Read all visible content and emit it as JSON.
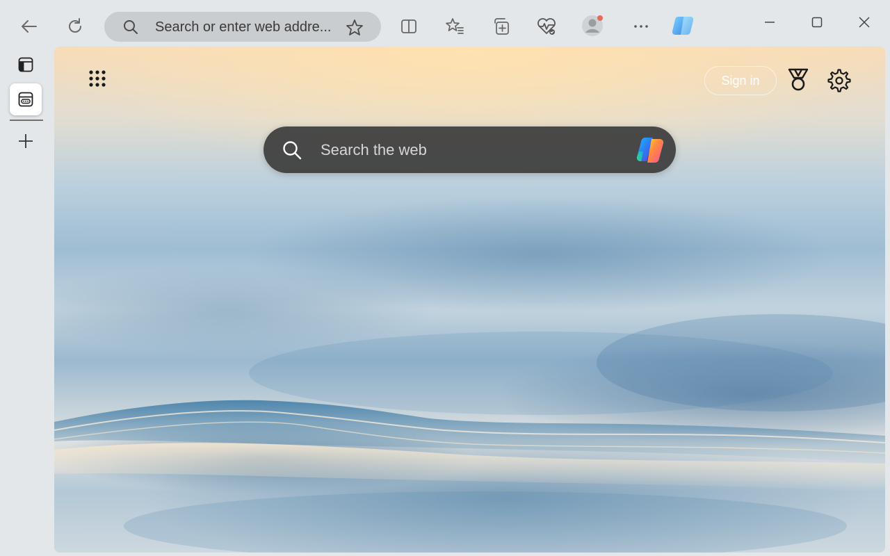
{
  "toolbar": {
    "address_placeholder": "Search or enter web addre...",
    "back_icon": "arrow-left-icon",
    "refresh_icon": "refresh-icon",
    "favorite_icon": "star-icon",
    "split_icon": "split-screen-icon",
    "favorites_icon": "favorites-icon",
    "collections_icon": "collections-icon",
    "health_icon": "browser-essentials-icon",
    "profile_icon": "profile-icon",
    "more_icon": "ellipsis-icon",
    "copilot_icon": "copilot-icon"
  },
  "window_controls": {
    "minimize_icon": "minimize-icon",
    "maximize_icon": "maximize-icon",
    "close_icon": "close-icon"
  },
  "tabs": {
    "items": [
      {
        "icon": "tab-actions-icon",
        "active": false
      },
      {
        "icon": "new-tab-page-icon",
        "active": true
      }
    ],
    "new_tab_icon": "plus-icon"
  },
  "new_tab_page": {
    "apps_icon": "app-launcher-icon",
    "sign_in_label": "Sign in",
    "rewards_icon": "rewards-medal-icon",
    "settings_icon": "gear-icon",
    "search_placeholder": "Search the web",
    "search_icon": "search-icon",
    "copilot_icon": "copilot-icon"
  },
  "colors": {
    "chrome_bg": "#e3e7ea",
    "address_bg": "#c9cdd0",
    "searchbox_bg": "#3c3c3c",
    "profile_badge": "#e8685a"
  }
}
